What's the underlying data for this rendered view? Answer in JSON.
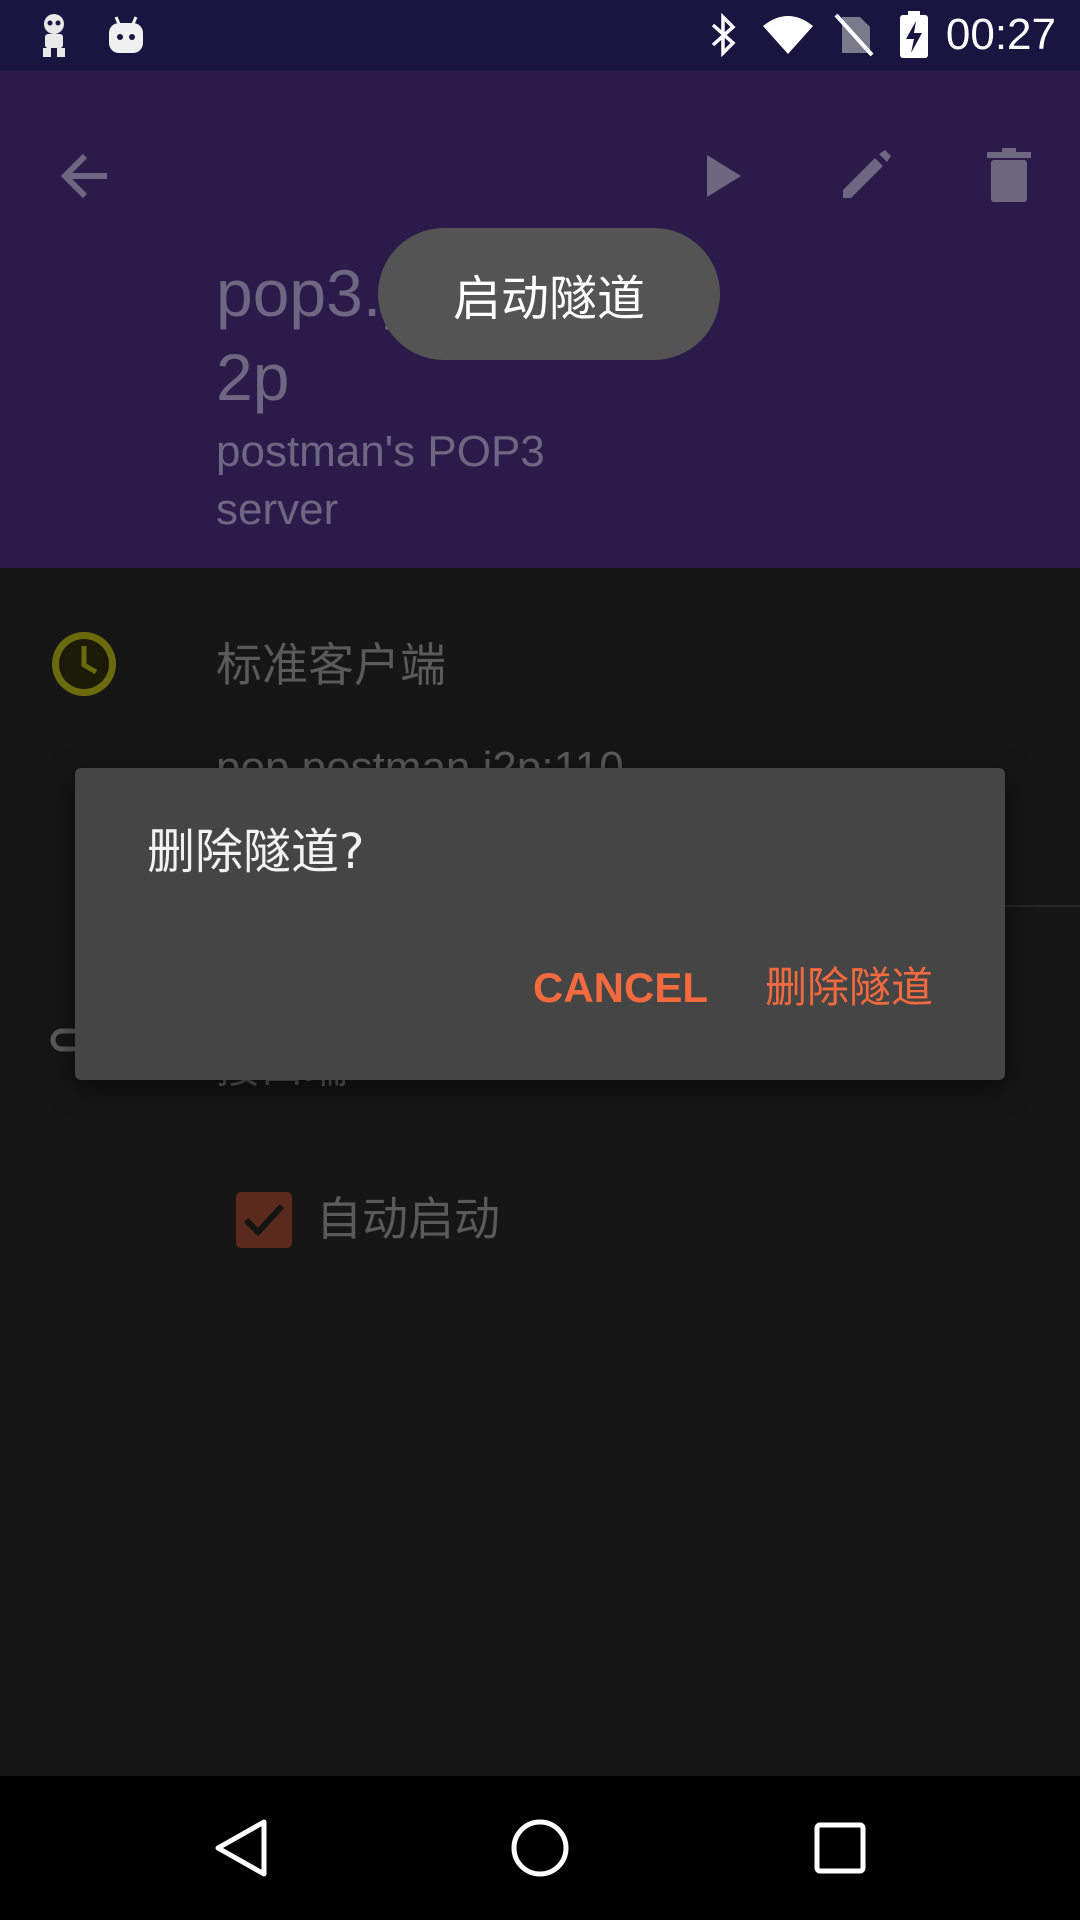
{
  "status_bar": {
    "time": "00:27",
    "left_icons": [
      "robot-icon",
      "android-icon"
    ],
    "right_icons": [
      "bluetooth-icon",
      "wifi-icon",
      "no-sim-icon",
      "battery-charging-icon"
    ]
  },
  "app_bar": {
    "background": "#2a1b4a",
    "title": "pop3.postman.i2p",
    "subtitle": "postman's POP3 server",
    "actions": [
      "back-icon",
      "play-icon",
      "edit-icon",
      "delete-icon"
    ]
  },
  "content": {
    "tunnel_type": "标准客户端",
    "tunnel_type_icon": "clock-icon",
    "target": "pop.postman.i2p:110",
    "section_label": "接口端",
    "section_icon": "link-icon",
    "autostart_label": "自动启动",
    "autostart_checked": true
  },
  "toast": {
    "text": "启动隧道"
  },
  "dialog": {
    "title": "删除隧道?",
    "cancel_label": "CANCEL",
    "confirm_label": "删除隧道",
    "accent": "#f26a3e"
  },
  "nav_bar": {
    "buttons": [
      "back-triangle-icon",
      "home-circle-icon",
      "recents-square-icon"
    ]
  }
}
